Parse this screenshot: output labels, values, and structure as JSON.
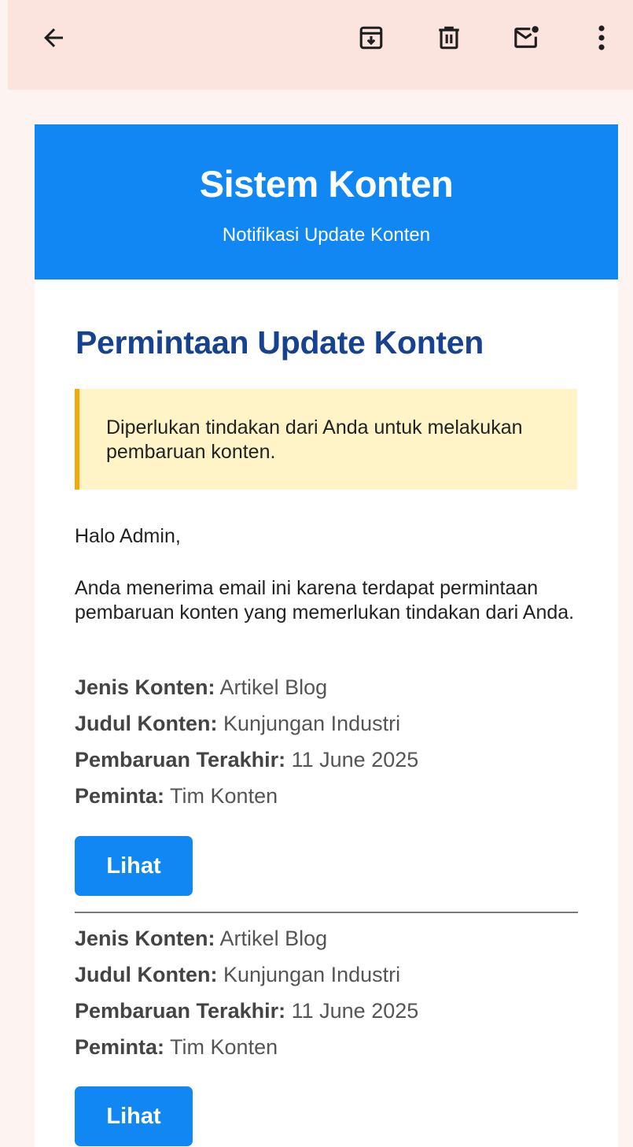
{
  "toolbar": {
    "icons": [
      "back-arrow-icon",
      "archive-icon",
      "delete-icon",
      "mark-unread-icon",
      "more-vert-icon"
    ]
  },
  "email": {
    "banner": {
      "title": "Sistem Konten",
      "subtitle": "Notifikasi Update Konten",
      "color": "#1187f4"
    },
    "heading": "Permintaan Update Konten",
    "alert": {
      "text": "Diperlukan tindakan dari Anda untuk melakukan pembaruan konten.",
      "background": "#fff4c7",
      "border_color": "#f5a70c"
    },
    "greeting": "Halo Admin,",
    "body": "Anda menerima email ini karena terdapat permintaan pembaruan konten yang memerlukan tindakan dari Anda.",
    "items": [
      {
        "jenis_label": "Jenis Konten:",
        "jenis_value": "Artikel Blog",
        "judul_label": "Judul Konten:",
        "judul_value": "Kunjungan Industri",
        "pembaruan_label": "Pembaruan Terakhir:",
        "pembaruan_value": "11 June 2025",
        "peminta_label": "Peminta:",
        "peminta_value": "Tim Konten",
        "button_label": "Lihat"
      },
      {
        "jenis_label": "Jenis Konten:",
        "jenis_value": "Artikel Blog",
        "judul_label": "Judul Konten:",
        "judul_value": "Kunjungan Industri",
        "pembaruan_label": "Pembaruan Terakhir:",
        "pembaruan_value": "11 June 2025",
        "peminta_label": "Peminta:",
        "peminta_value": "Tim Konten",
        "button_label": "Lihat"
      }
    ]
  }
}
